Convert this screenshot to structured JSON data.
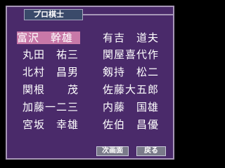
{
  "title": "プロ棋士",
  "players_left": [
    "富沢　幹雄",
    "丸田　祐三",
    "北村　昌男",
    "関根　　茂",
    "加藤一二三",
    "宮坂　幸雄"
  ],
  "players_right": [
    "有吉　道夫",
    "関屋喜代作",
    "剱持　松二",
    "佐藤大五郎",
    "内藤　国雄",
    "佐伯　昌優"
  ],
  "selected": "富沢　幹雄",
  "buttons": {
    "next": "次画面",
    "back": "戻る"
  },
  "colors": {
    "panel": "#4a2a6a",
    "highlight": "#c878a8",
    "border": "#a898b8"
  }
}
